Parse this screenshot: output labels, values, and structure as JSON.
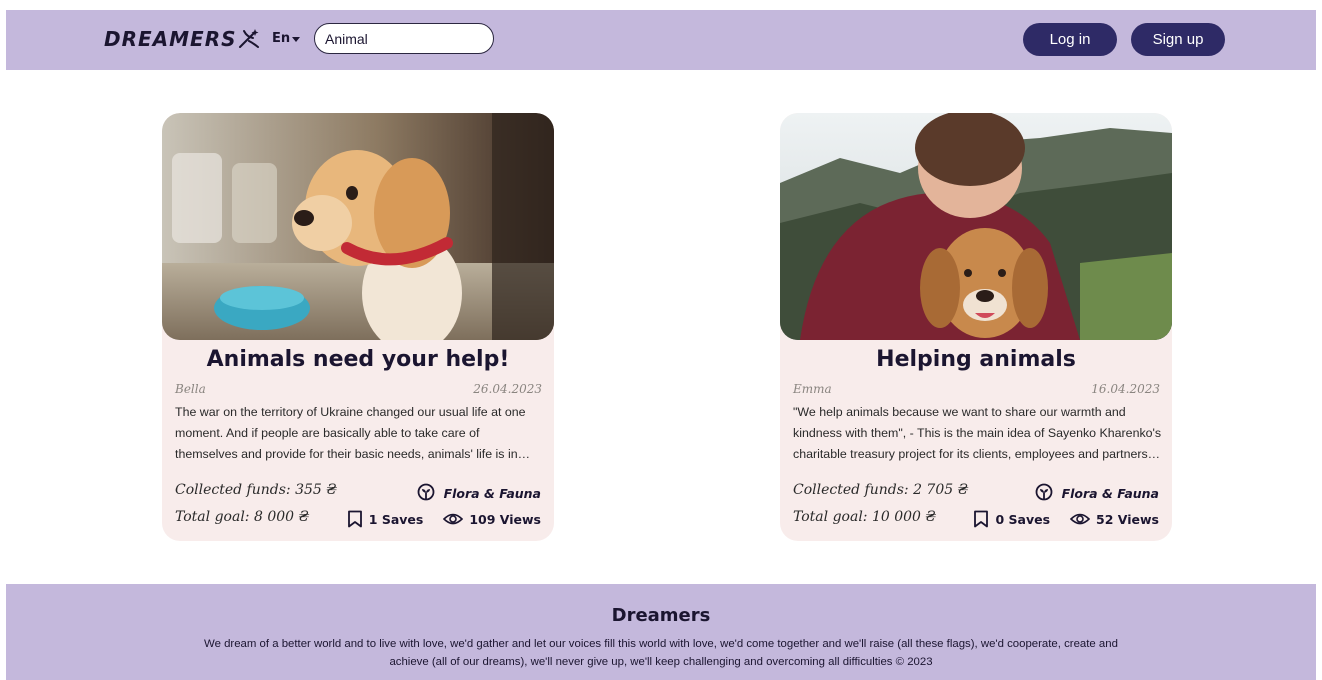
{
  "header": {
    "logo_text": "DREAMERS",
    "logo_icon": "sparkle-icon",
    "language": "En",
    "search_value": "Animal",
    "login_label": "Log in",
    "signup_label": "Sign up",
    "bar_color": "#c4b8dc",
    "button_color": "#2e2a66"
  },
  "cards": [
    {
      "title": "Animals need your help!",
      "author": "Bella",
      "date": "26.04.2023",
      "description": "The war on the territory of Ukraine changed our usual life at one moment. And if people are basically able to take care of themselves and provide for their basic needs, animals' life is in…",
      "collected": "Collected funds: 355 ₴",
      "goal": "Total goal: 8 000 ₴",
      "category": "Flora & Fauna",
      "saves": "1 Saves",
      "views": "109 Views",
      "image": "puppy-photo"
    },
    {
      "title": "Helping animals",
      "author": "Emma",
      "date": "16.04.2023",
      "description": "\"We help animals because we want to share our warmth and kindness with them\", - This is the main idea of Sayenko Kharenko's charitable treasury project for its clients, employees and partners…",
      "collected": "Collected funds: 2 705 ₴",
      "goal": "Total goal: 10 000 ₴",
      "category": "Flora & Fauna",
      "saves": "0 Saves",
      "views": "52 Views",
      "image": "man-hugging-dog-photo"
    }
  ],
  "footer": {
    "title": "Dreamers",
    "text": "We dream of a better world and to live with love, we'd gather and let our voices fill this world with love, we'd come together and we'll raise (all these flags), we'd cooperate, create and achieve (all of our dreams), we'll never give up, we'll keep challenging and overcoming all difficulties © 2023"
  }
}
